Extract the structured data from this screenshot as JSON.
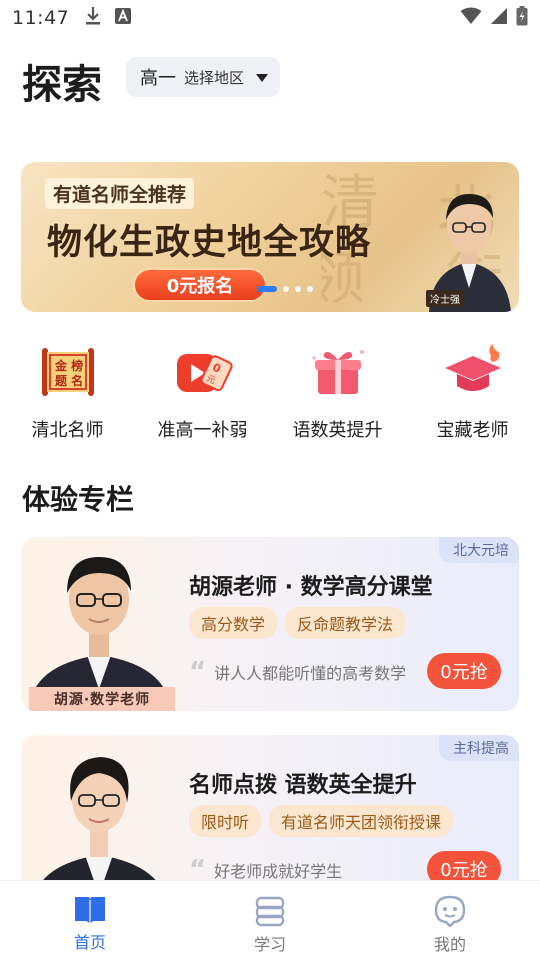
{
  "status_bar": {
    "time": "11:47"
  },
  "header": {
    "title": "探索",
    "grade": "高一",
    "region": "选择地区"
  },
  "banner": {
    "subtitle": "有道名师全推荐",
    "title": "物化生政史地全攻略",
    "cta": "0元报名",
    "teacher_tag": "冷士强",
    "dot_count": 4,
    "active_dot": 0
  },
  "categories": [
    {
      "label": "清北名师",
      "icon": "gold-list-icon"
    },
    {
      "label": "准高一补弱",
      "icon": "video-free-icon"
    },
    {
      "label": "语数英提升",
      "icon": "gift-icon"
    },
    {
      "label": "宝藏老师",
      "icon": "graduation-cap-icon"
    }
  ],
  "section": {
    "title": "体验专栏"
  },
  "courses": [
    {
      "tag": "北大元培",
      "photo_label": "胡源·数学老师",
      "title": "胡源老师 · 数学高分课堂",
      "badges": [
        "高分数学",
        "反命题教学法"
      ],
      "quote": "讲人人都能听懂的高考数学",
      "price": "0元抢"
    },
    {
      "tag": "主科提高",
      "title": "名师点拨 语数英全提升",
      "badges": [
        "限时听",
        "有道名师天团领衔授课"
      ],
      "quote": "好老师成就好学生",
      "price": "0元抢"
    }
  ],
  "bottom_nav": [
    {
      "label": "首页",
      "active": true,
      "icon": "book-icon"
    },
    {
      "label": "学习",
      "active": false,
      "icon": "stack-icon"
    },
    {
      "label": "我的",
      "active": false,
      "icon": "face-icon"
    }
  ],
  "colors": {
    "accent": "#2f6de8",
    "price": "#f4533b",
    "badge_bg": "#fbe7cf"
  }
}
